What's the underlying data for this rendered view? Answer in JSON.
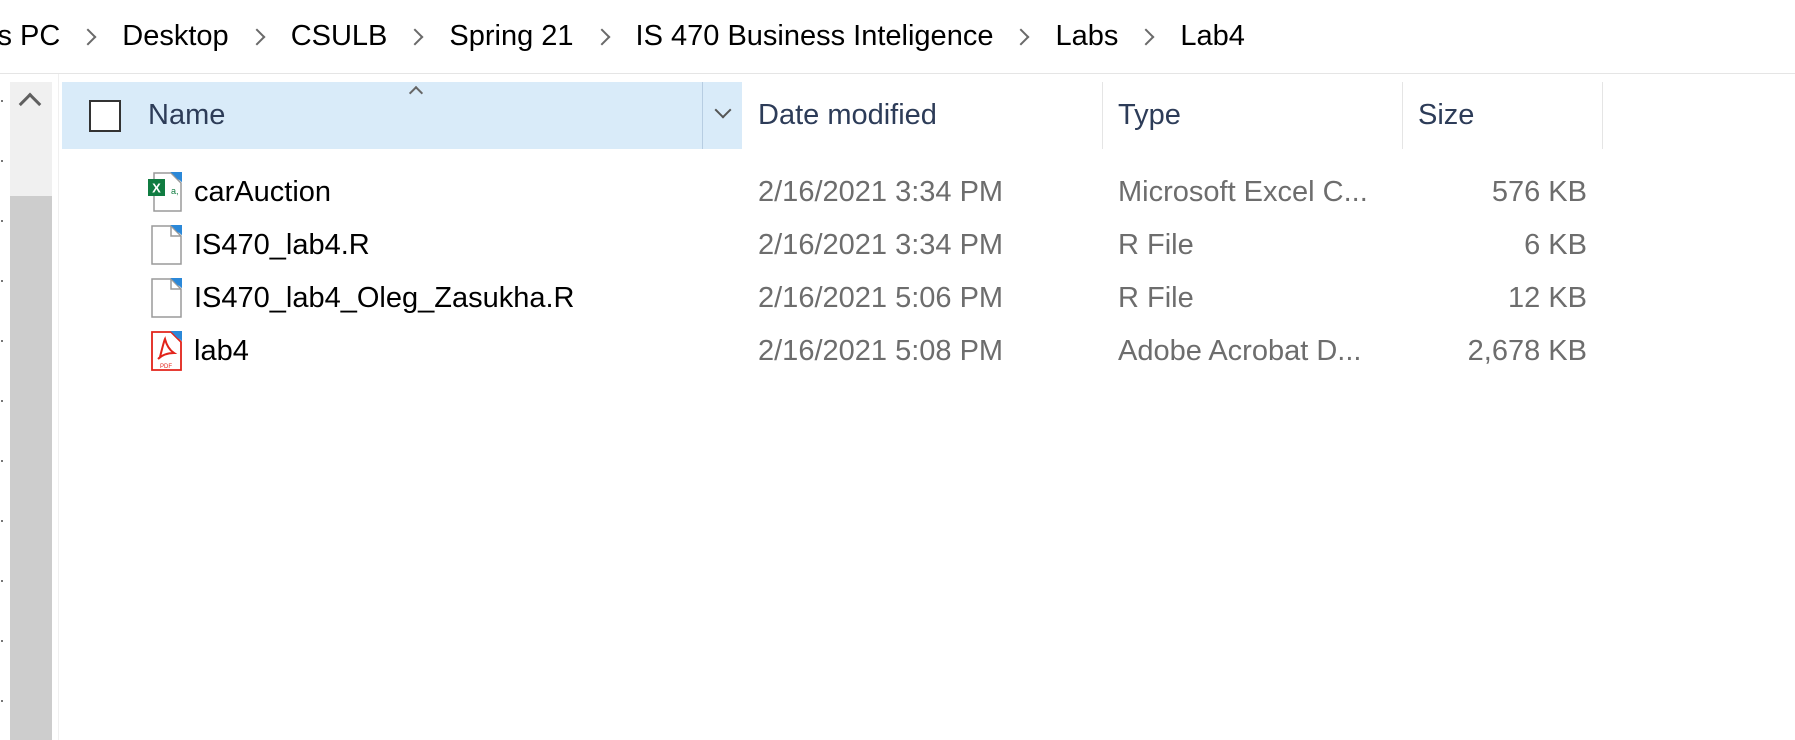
{
  "breadcrumb": {
    "items": [
      {
        "label": "is PC"
      },
      {
        "label": "Desktop"
      },
      {
        "label": "CSULB"
      },
      {
        "label": "Spring 21"
      },
      {
        "label": "IS 470 Business Inteligence"
      },
      {
        "label": "Labs"
      },
      {
        "label": "Lab4"
      }
    ]
  },
  "columns": {
    "name": "Name",
    "date": "Date modified",
    "type": "Type",
    "size": "Size"
  },
  "files": [
    {
      "name": "carAuction",
      "date": "2/16/2021 3:34 PM",
      "type": "Microsoft Excel C...",
      "size": "576 KB",
      "icon": "excel-file-icon"
    },
    {
      "name": "IS470_lab4.R",
      "date": "2/16/2021 3:34 PM",
      "type": "R File",
      "size": "6 KB",
      "icon": "r-file-icon"
    },
    {
      "name": "IS470_lab4_Oleg_Zasukha.R",
      "date": "2/16/2021 5:06 PM",
      "type": "R File",
      "size": "12 KB",
      "icon": "r-file-icon"
    },
    {
      "name": "lab4",
      "date": "2/16/2021 5:08 PM",
      "type": "Adobe Acrobat D...",
      "size": "2,678 KB",
      "icon": "pdf-file-icon"
    }
  ],
  "colors": {
    "header_selected": "#d9ebf9",
    "header_text": "#2d3c58",
    "secondary_text": "#6d6d6d",
    "excel_green": "#107c41",
    "pdf_red": "#e2231a"
  }
}
